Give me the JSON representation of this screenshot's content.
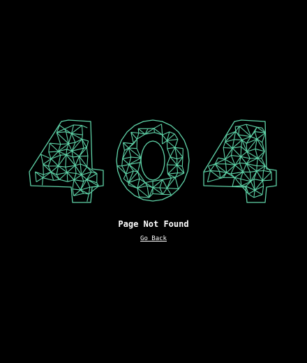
{
  "error": {
    "code_digits": [
      "4",
      "0",
      "4"
    ],
    "title": "Page Not Found",
    "back_link_label": "Go Back"
  },
  "colors": {
    "background": "#000000",
    "mesh_stroke": "#5fd3a8",
    "text": "#ffffff"
  }
}
